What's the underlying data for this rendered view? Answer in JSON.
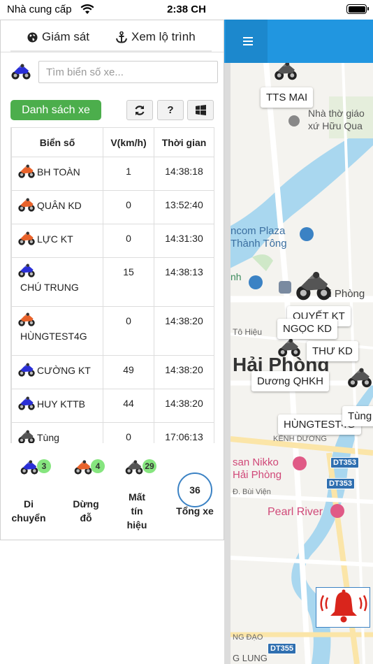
{
  "status_bar": {
    "carrier": "Nhà cung cấp",
    "time": "2:38 CH"
  },
  "tabs": {
    "monitor": "Giám sát",
    "route": "Xem lộ trình"
  },
  "search": {
    "placeholder": "Tìm biển số xe..."
  },
  "toolbar": {
    "list_label": "Danh sách xe",
    "help_label": "?"
  },
  "table": {
    "headers": [
      "Biển số",
      "V(km/h)",
      "Thời gian"
    ],
    "rows": [
      {
        "plate": "BH TOÀN",
        "speed": "1",
        "time": "14:38:18",
        "status": "stopped"
      },
      {
        "plate": "QUÂN KD",
        "speed": "0",
        "time": "13:52:40",
        "status": "stopped"
      },
      {
        "plate": "LỰC KT",
        "speed": "0",
        "time": "14:31:30",
        "status": "stopped"
      },
      {
        "plate": "CHÚ TRUNG",
        "speed": "15",
        "time": "14:38:13",
        "status": "moving"
      },
      {
        "plate": "HÙNGTEST4G",
        "speed": "0",
        "time": "14:38:20",
        "status": "stopped"
      },
      {
        "plate": "CƯỜNG KT",
        "speed": "49",
        "time": "14:38:20",
        "status": "moving"
      },
      {
        "plate": "HUY KTTB",
        "speed": "44",
        "time": "14:38:20",
        "status": "moving"
      },
      {
        "plate": "Tùng",
        "speed": "0",
        "time": "17:06:13",
        "status": "lost"
      }
    ]
  },
  "summary": {
    "moving_count": "3",
    "moving_label_1": "Di",
    "moving_label_2": "chuyển",
    "stopped_count": "4",
    "stopped_label_1": "Dừng",
    "stopped_label_2": "đỗ",
    "lost_count": "29",
    "lost_label_1": "Mất",
    "lost_label_2": "tín",
    "lost_label_3": "hiệu",
    "total_count": "36",
    "total_label": "Tổng xe"
  },
  "map": {
    "labels": {
      "tts_mai": "TTS MAI",
      "quyet": "QUYẾT KT",
      "ngoc": "NGỌC KD",
      "thu": "THƯ KD",
      "duong": "Dương QHKH",
      "hungtest": "HÙNGTEST4G",
      "tung": "Tùng"
    },
    "places": {
      "church_1": "Nhà thờ giáo",
      "church_2": "xứ Hữu Qua",
      "vincom_1": "ncom Plaza",
      "vincom_2": "Thành Tông",
      "haiphong_small": "ải Phòng",
      "to_hieu": "Tô Hiệu",
      "city": "Hải Phòng",
      "kenh_duong": "KÊNH DƯƠNG",
      "nikko_1": "san Nikko",
      "nikko_2": "Hải Phòng",
      "bui_vien": "Đ. Bùi Viện",
      "pearl": "Pearl River",
      "ng_dao": "NG ĐẠO",
      "g_lung": "G LUNG",
      "nh": "nh"
    },
    "roads": {
      "dt353_a": "DT353",
      "dt353_b": "DT353",
      "dt355": "DT355"
    }
  },
  "colors": {
    "accent_blue": "#2196e0",
    "list_button_green": "#4cae4c",
    "badge_green": "#86e57f",
    "moto_stopped": "#e8622a",
    "moto_moving": "#2a2fd6",
    "moto_lost": "#555555",
    "bell_red": "#d9251c"
  }
}
